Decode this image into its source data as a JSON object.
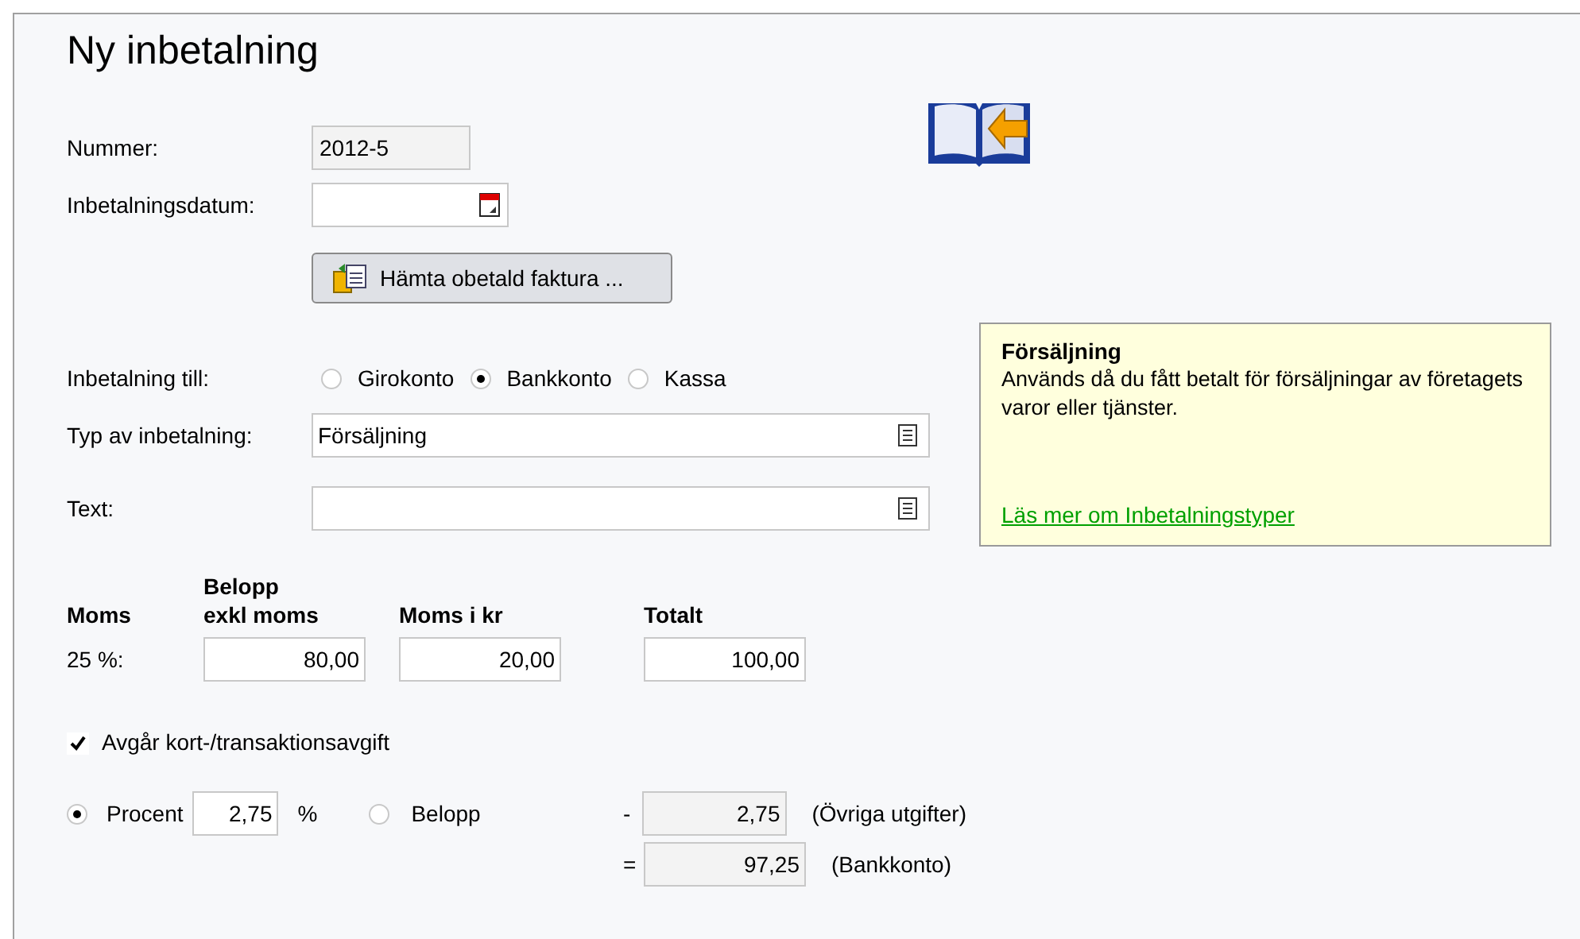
{
  "title": "Ny inbetalning",
  "number": {
    "label": "Nummer:",
    "value": "2012-5"
  },
  "date": {
    "label": "Inbetalningsdatum:"
  },
  "fetch_button": "Hämta obetald faktura ...",
  "payment_to": {
    "label": "Inbetalning till:",
    "options": [
      {
        "label": "Girokonto",
        "selected": false
      },
      {
        "label": "Bankkonto",
        "selected": true
      },
      {
        "label": "Kassa",
        "selected": false
      }
    ]
  },
  "type": {
    "label": "Typ av inbetalning:",
    "value": "Försäljning"
  },
  "text": {
    "label": "Text:"
  },
  "info_box": {
    "title": "Försäljning",
    "body": "Används då du fått betalt för försäljningar av företagets varor eller tjänster.",
    "link": "Läs mer om Inbetalningstyper"
  },
  "vat": {
    "headers": [
      "Moms",
      "Belopp\nexkl moms",
      "Moms i kr",
      "Totalt"
    ],
    "rate": "25 %:",
    "values": [
      "80,00",
      "20,00",
      "100,00"
    ]
  },
  "fee": {
    "label": "Avgår kort-/transaktionsavgift",
    "checked": true,
    "modes": [
      {
        "label": "Procent",
        "selected": true
      },
      {
        "label": "Belopp",
        "selected": false
      }
    ],
    "percent": "2,75",
    "unit": "%",
    "lines": [
      {
        "sign": "-",
        "value": "2,75",
        "note": "(Övriga utgifter)"
      },
      {
        "sign": "=",
        "value": "97,25",
        "note": "(Bankkonto)"
      }
    ]
  }
}
